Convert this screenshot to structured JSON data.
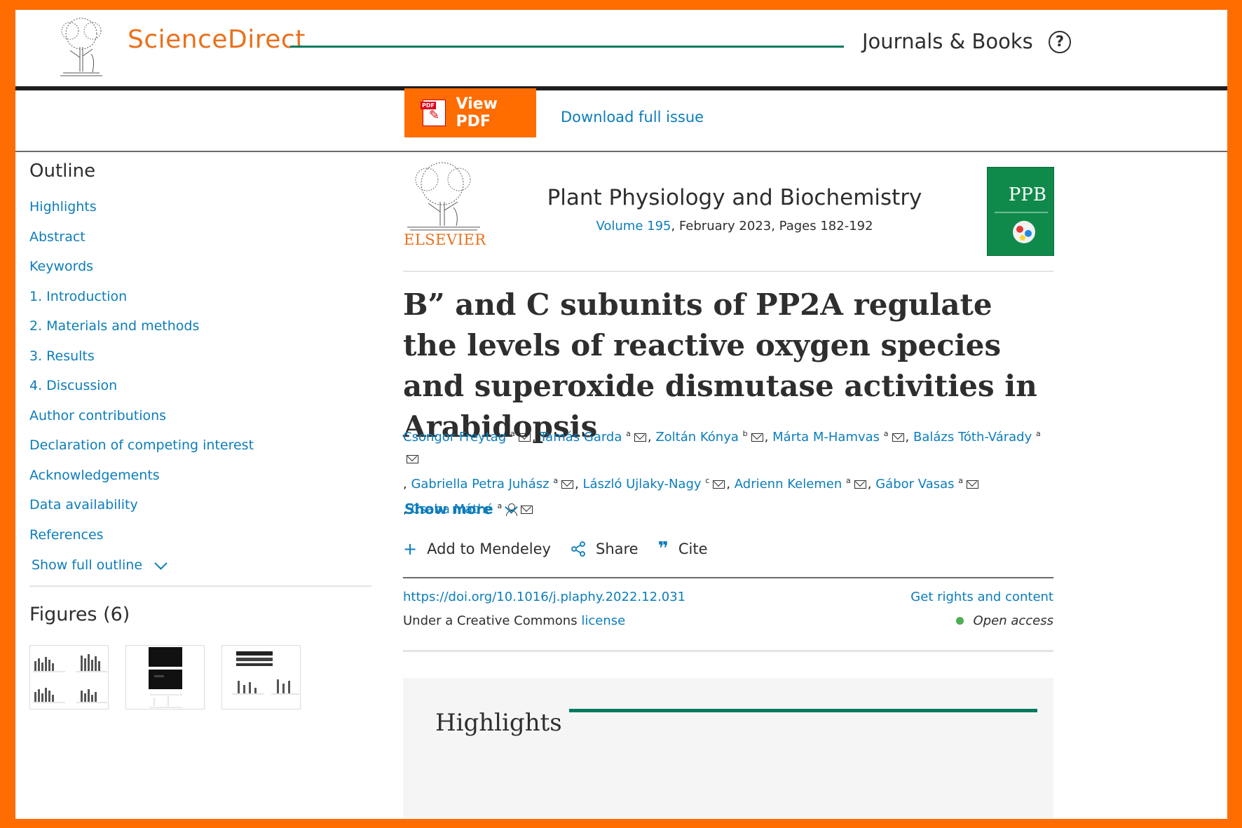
{
  "header": {
    "brand": "ScienceDirect",
    "nav_label": "Journals & Books",
    "help_glyph": "?"
  },
  "toolbar": {
    "view_pdf": "View PDF",
    "download_issue": "Download full issue"
  },
  "sidebar": {
    "outline_title": "Outline",
    "items": [
      {
        "label": "Highlights"
      },
      {
        "label": "Abstract"
      },
      {
        "label": "Keywords"
      },
      {
        "label": "1. Introduction"
      },
      {
        "label": "2. Materials and methods"
      },
      {
        "label": "3. Results"
      },
      {
        "label": "4. Discussion"
      },
      {
        "label": "Author contributions"
      },
      {
        "label": "Declaration of competing interest"
      },
      {
        "label": "Acknowledgements"
      },
      {
        "label": "Data availability"
      },
      {
        "label": "References"
      }
    ],
    "show_full_outline": "Show full outline",
    "figures_title": "Figures (6)"
  },
  "article": {
    "publisher": "ELSEVIER",
    "journal": "Plant Physiology and Biochemistry",
    "volume_link": "Volume 195",
    "volume_rest": ", February 2023, Pages 182-192",
    "cover_label": "PPB",
    "title": "B” and C subunits of PP2A regulate the levels of reactive oxygen species and superoxide dismutase activities in Arabidopsis",
    "authors": [
      {
        "name": "Csongor Freytag",
        "sup": "a"
      },
      {
        "name": "Tamás Garda",
        "sup": "a"
      },
      {
        "name": "Zoltán Kónya",
        "sup": "b"
      },
      {
        "name": "Márta M-Hamvas",
        "sup": "a"
      },
      {
        "name": "Balázs Tóth-Várady",
        "sup": "a"
      },
      {
        "name": "Gabriella Petra Juhász",
        "sup": "a"
      },
      {
        "name": "László Ujlaky-Nagy",
        "sup": "c"
      },
      {
        "name": "Adrienn Kelemen",
        "sup": "a"
      },
      {
        "name": "Gábor Vasas",
        "sup": "a"
      },
      {
        "name": "Csaba Máthé",
        "sup": "a"
      }
    ],
    "show_more": "Show more",
    "actions": {
      "mendeley": "Add to Mendeley",
      "share": "Share",
      "cite": "Cite"
    },
    "doi": "https://doi.org/10.1016/j.plaphy.2022.12.031",
    "rights": "Get rights and content",
    "license_prefix": "Under a Creative Commons ",
    "license_link": "license",
    "open_access": "Open access",
    "highlights_heading": "Highlights"
  },
  "colors": {
    "brand_orange": "#e9711c",
    "accent_orange": "#ff6c00",
    "link_blue": "#0c7dbb",
    "rule_green": "#007a5e",
    "open_access_green": "#4caf50"
  }
}
